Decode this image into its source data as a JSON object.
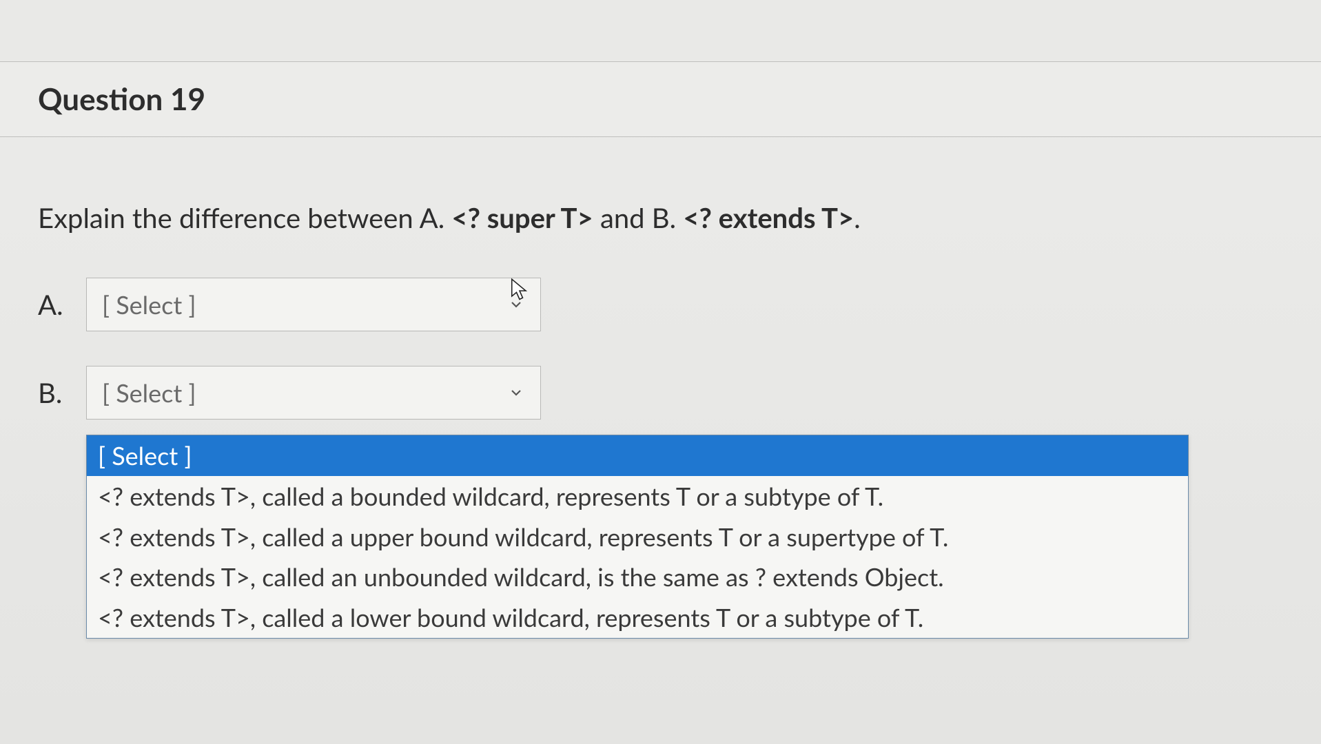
{
  "question": {
    "title": "Question 19",
    "prompt_prefix": "Explain the difference between A. ",
    "prompt_bold1": "<? super T>",
    "prompt_mid": " and B. ",
    "prompt_bold2": "<? extends T>",
    "prompt_suffix": "."
  },
  "answers": {
    "a": {
      "label": "A.",
      "placeholder": "[ Select ]"
    },
    "b": {
      "label": "B.",
      "placeholder": "[ Select ]"
    }
  },
  "dropdown": {
    "options": [
      "[ Select ]",
      "<? extends T>, called a bounded wildcard, represents T or a subtype of T.",
      "<? extends T>, called a upper bound wildcard, represents T or a supertype of T.",
      "<? extends T>, called an unbounded wildcard, is the same as ? extends Object.",
      "<? extends T>, called a lower bound wildcard, represents T or a subtype of T."
    ],
    "selected_index": 0
  },
  "colors": {
    "highlight": "#1f77d0",
    "text": "#2d2d2d",
    "muted": "#6a6a6a",
    "border": "#b8b8b6",
    "bg": "#ececea"
  }
}
